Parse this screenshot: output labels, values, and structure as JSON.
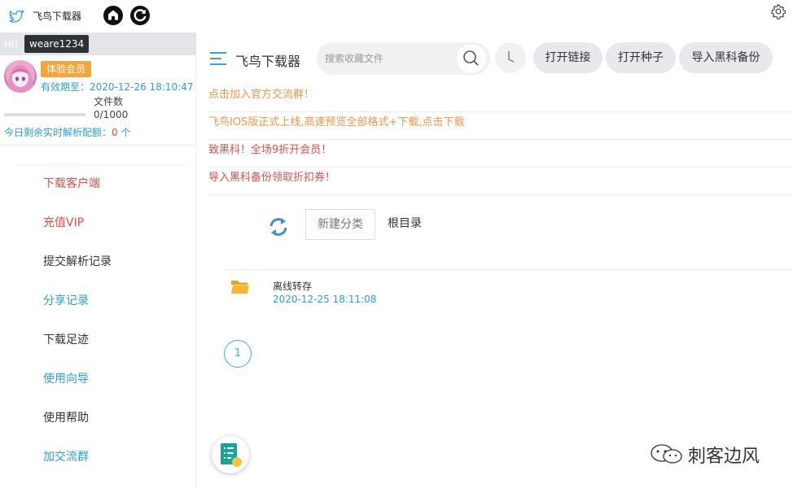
{
  "titlebar": {
    "title": "飞鸟下载器",
    "icons": [
      "bird-logo-icon",
      "home-icon",
      "refresh-icon",
      "gear-icon"
    ]
  },
  "sidebar": {
    "greeting": "Hi！",
    "username": "weare1234",
    "member_badge": "体验会员",
    "expiry": "有效期至：2020-12-26 18:10:47",
    "files_label": "文件数",
    "files_count": "0/1000",
    "files_used_fraction": 0,
    "quota_text": "今日剩余实时解析配额：",
    "quota_value": "0",
    "quota_unit": " 个",
    "menu": [
      {
        "label": "下载客户端",
        "color": "#e24d4d"
      },
      {
        "label": "充值VIP",
        "color": "#e24d4d"
      },
      {
        "label": "提交解析记录",
        "color": "#333333"
      },
      {
        "label": "分享记录",
        "color": "#2aa0d8"
      },
      {
        "label": "下载足迹",
        "color": "#333333"
      },
      {
        "label": "使用向导",
        "color": "#2aa0d8"
      },
      {
        "label": "使用帮助",
        "color": "#333333"
      },
      {
        "label": "加交流群",
        "color": "#2aa0d8"
      }
    ]
  },
  "toolbar": {
    "app_title": "飞鸟下载器",
    "search_placeholder": "搜索收藏文件",
    "buttons": [
      "打开链接",
      "打开种子",
      "导入黑科备份"
    ]
  },
  "notices": [
    {
      "text": "点击加入官方交流群！",
      "color": "#f0974a"
    },
    {
      "text": "飞鸟IOS版正式上线,高速预览全部格式+下载,点击下载",
      "color": "#f0974a"
    },
    {
      "text": "致黑科！全场9折开会员！",
      "color": "#e24d4d"
    },
    {
      "text": "导入黑科备份领取折扣券！",
      "color": "#e24d4d"
    }
  ],
  "actions": {
    "new_category": "新建分类",
    "root_label": "根目录"
  },
  "files": [
    {
      "name": "离线转存",
      "date": "2020-12-25 18:11:08",
      "icon": "folder-icon"
    }
  ],
  "pagination": {
    "current_page": "1"
  },
  "watermark": {
    "text": "刺客边风",
    "icon": "wechat-icon"
  },
  "colors": {
    "accent_blue": "#2aa0d8",
    "red": "#e24d4d",
    "orange": "#f0974a",
    "teal": "#2ec4b6",
    "badge": "#f5a53a"
  }
}
